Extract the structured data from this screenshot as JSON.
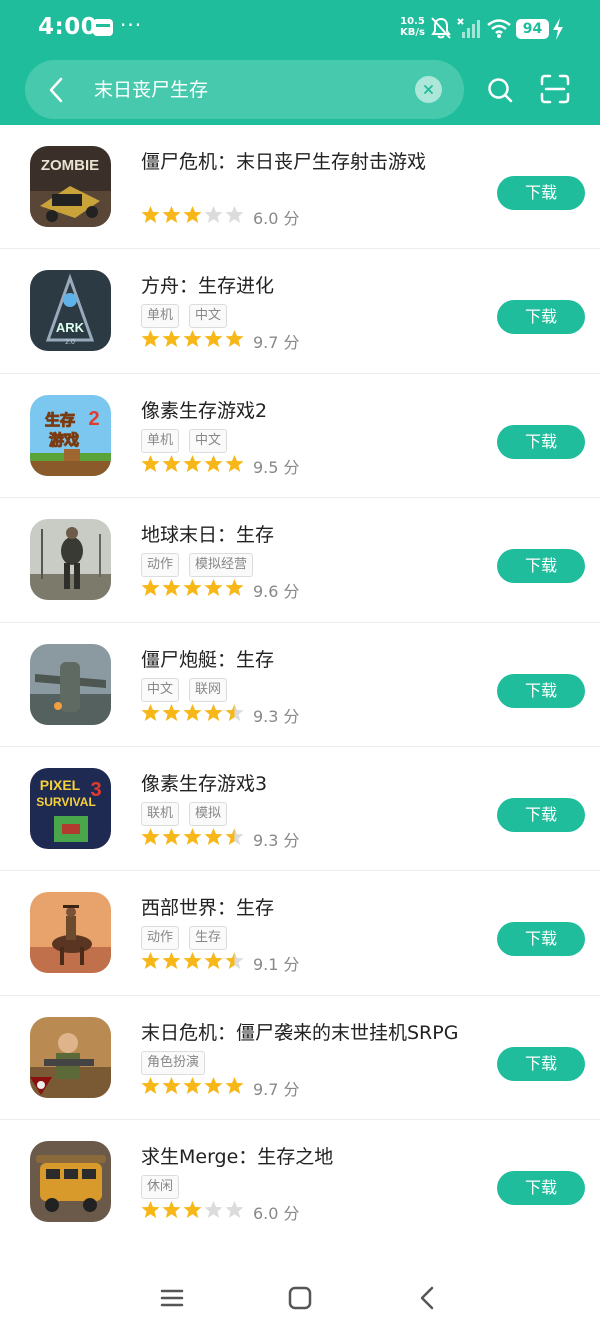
{
  "status_bar": {
    "time": "4:00",
    "dots": "···",
    "net_speed_value": "10.5",
    "net_speed_unit": "KB/s",
    "battery": "94"
  },
  "search": {
    "query": "末日丧尸生存"
  },
  "colors": {
    "accent": "#1fbd9c",
    "star": "#f7b718",
    "star_empty": "#dcdcdc"
  },
  "apps": [
    {
      "name": "僵尸危机：末日丧尸生存射击游戏",
      "tags": [],
      "rating": 3,
      "score": "6.0 分",
      "button": "下载",
      "icon": "zombie-game-icon"
    },
    {
      "name": "方舟：生存进化",
      "tags": [
        "单机",
        "中文"
      ],
      "rating": 5,
      "score": "9.7 分",
      "button": "下载",
      "icon": "ark-game-icon"
    },
    {
      "name": "像素生存游戏2",
      "tags": [
        "单机",
        "中文"
      ],
      "rating": 5,
      "score": "9.5 分",
      "button": "下载",
      "icon": "pixel-survival-2-icon"
    },
    {
      "name": "地球末日：生存",
      "tags": [
        "动作",
        "模拟经营"
      ],
      "rating": 5,
      "score": "9.6 分",
      "button": "下载",
      "icon": "last-day-on-earth-icon"
    },
    {
      "name": "僵尸炮艇：生存",
      "tags": [
        "中文",
        "联网"
      ],
      "rating": 4.5,
      "score": "9.3 分",
      "button": "下载",
      "icon": "gunship-icon"
    },
    {
      "name": "像素生存游戏3",
      "tags": [
        "联机",
        "模拟"
      ],
      "rating": 4.5,
      "score": "9.3 分",
      "button": "下载",
      "icon": "pixel-survival-3-icon"
    },
    {
      "name": "西部世界：生存",
      "tags": [
        "动作",
        "生存"
      ],
      "rating": 4.5,
      "score": "9.1 分",
      "button": "下载",
      "icon": "westland-icon"
    },
    {
      "name": "末日危机：僵尸袭来的末世挂机SRPG",
      "tags": [
        "角色扮演"
      ],
      "rating": 5,
      "score": "9.7 分",
      "button": "下载",
      "icon": "doomsday-srpg-icon"
    },
    {
      "name": "求生Merge：生存之地",
      "tags": [
        "休闲"
      ],
      "rating": 3,
      "score": "6.0 分",
      "button": "下载",
      "icon": "survival-merge-icon"
    }
  ]
}
